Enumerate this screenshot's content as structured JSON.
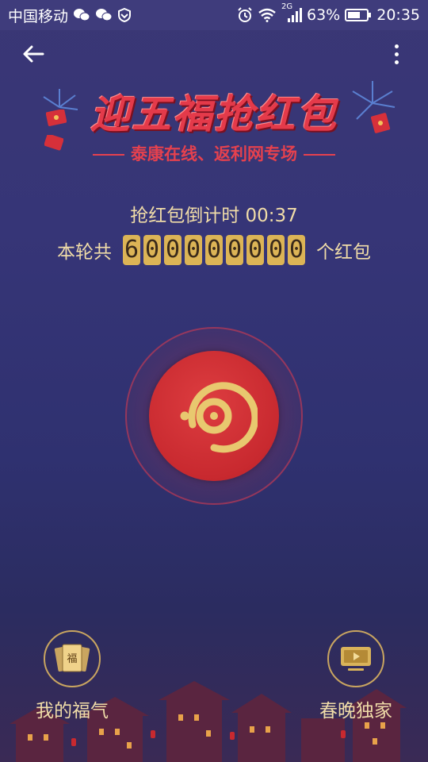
{
  "status_bar": {
    "carrier": "中国移动",
    "network": "2G",
    "battery": "63%",
    "time": "20:35"
  },
  "banner": {
    "title": "迎五福抢红包",
    "subtitle": "泰康在线、返利网专场"
  },
  "countdown": {
    "label": "抢红包倒计时",
    "time": "00:37"
  },
  "total": {
    "prefix": "本轮共",
    "digits": [
      "6",
      "0",
      "0",
      "0",
      "0",
      "0",
      "0",
      "0",
      "0"
    ],
    "suffix": "个红包"
  },
  "bottom": {
    "left_label": "我的福气",
    "left_badge": "福",
    "right_label": "春晚独家"
  },
  "colors": {
    "accent_red": "#c8292f",
    "gold": "#dcb456",
    "text_gold": "#f0dca8",
    "background": "#363577"
  },
  "icons": [
    "wechat-icon",
    "shield-icon",
    "alarm-icon",
    "wifi-icon",
    "signal-icon",
    "battery-icon",
    "back-arrow-icon",
    "more-vertical-icon",
    "red-packet-icon",
    "fortune-card-icon",
    "tv-play-icon"
  ]
}
